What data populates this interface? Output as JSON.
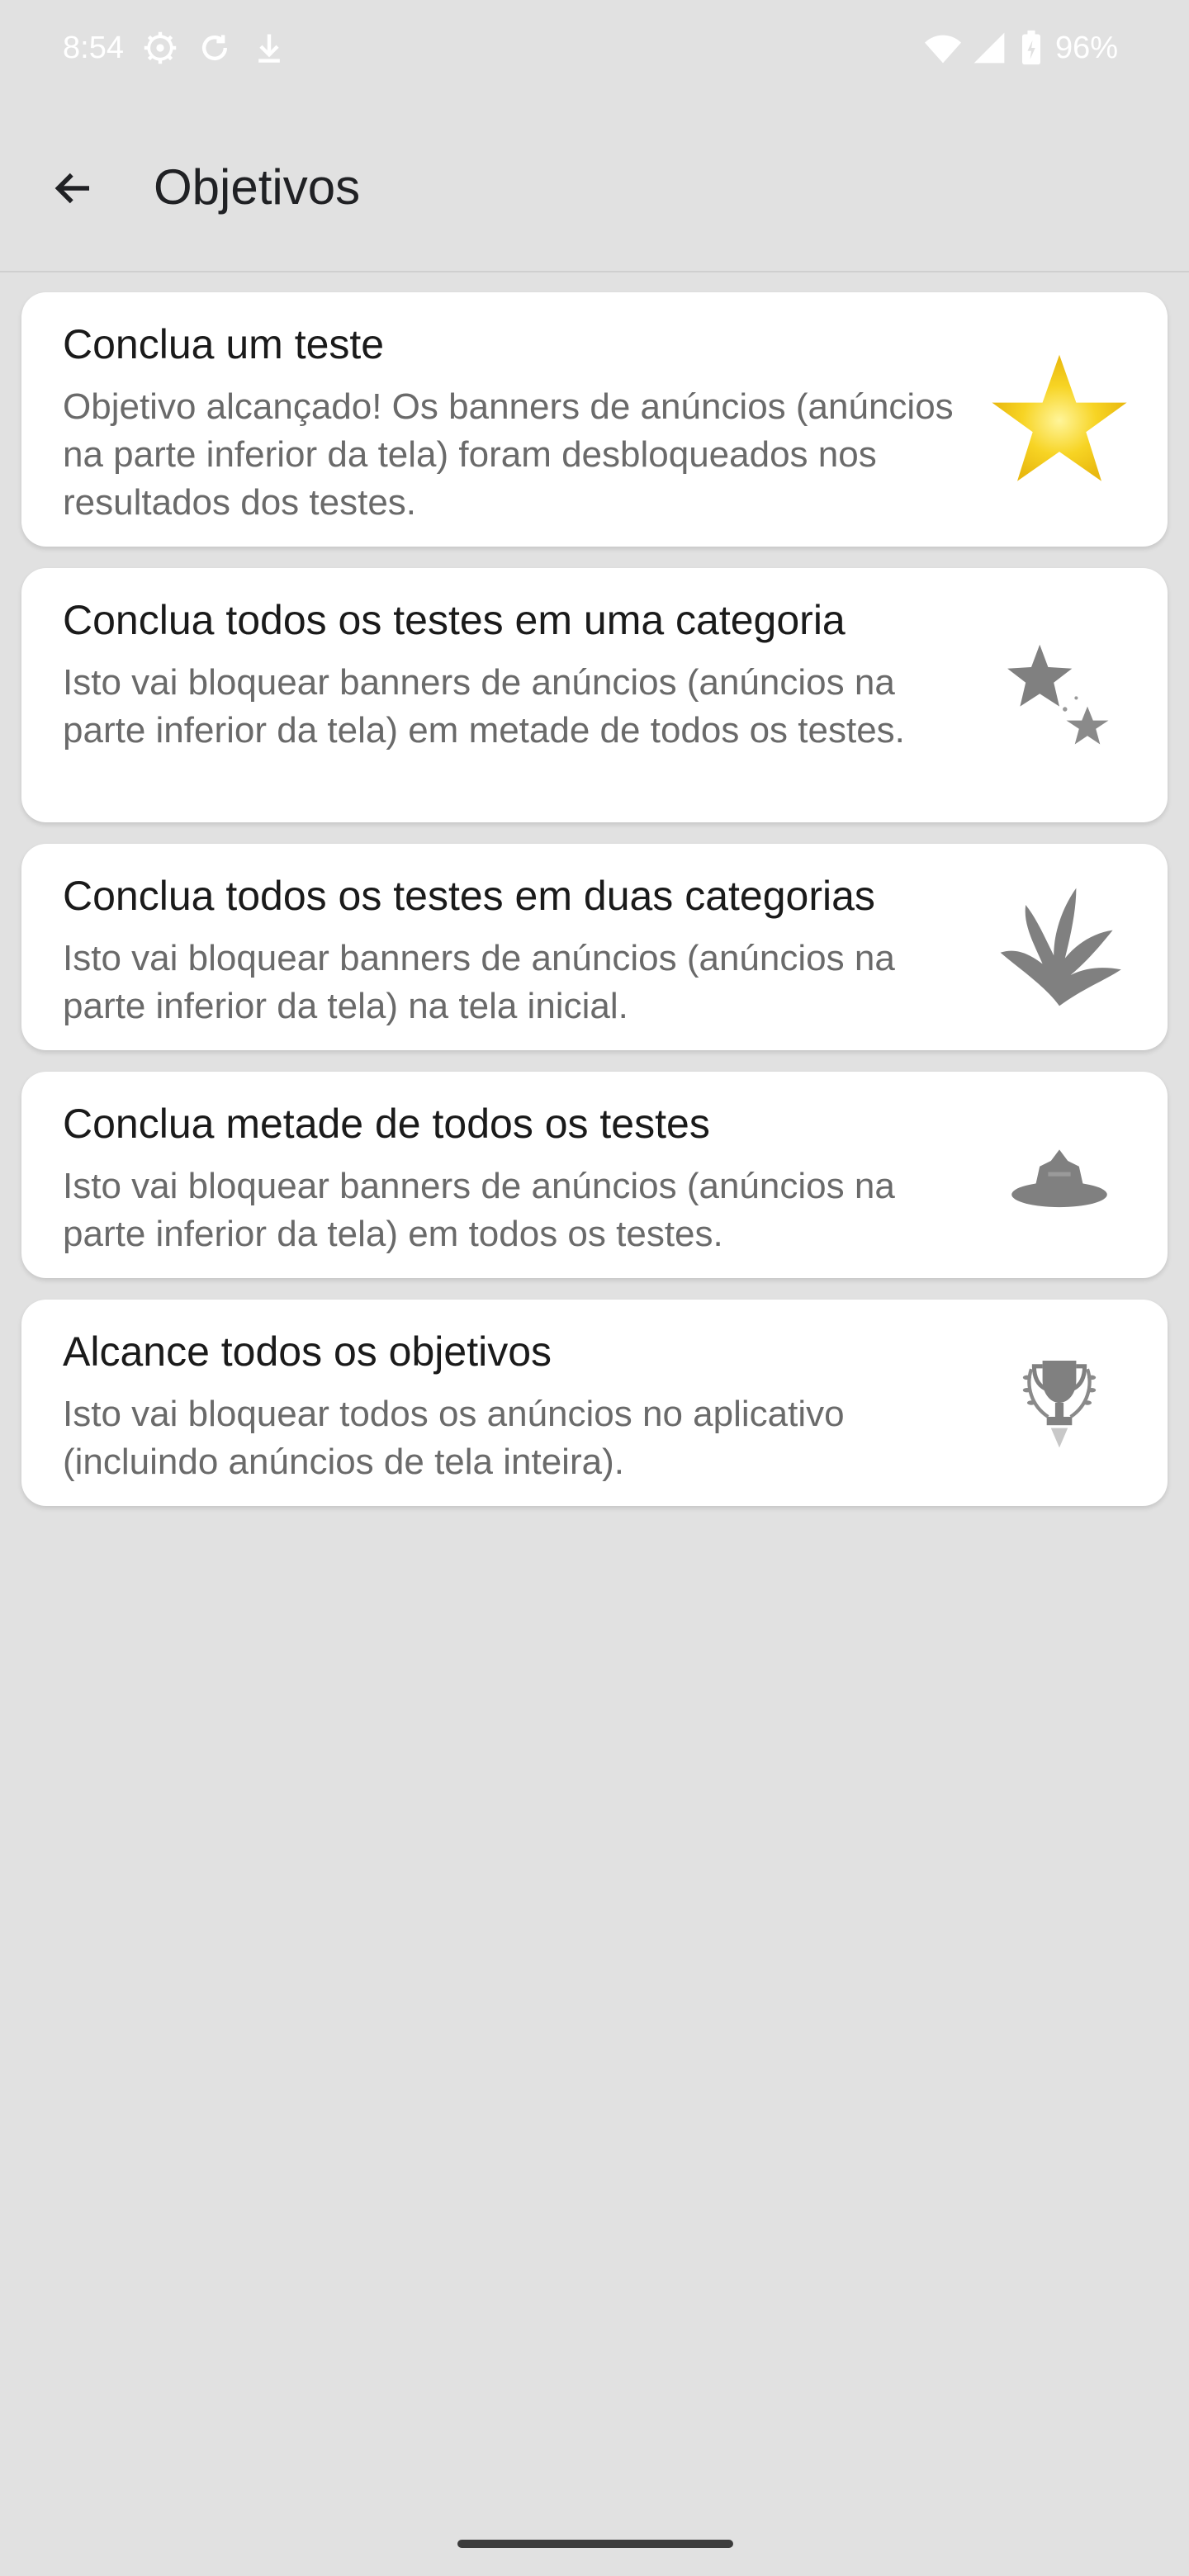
{
  "status_bar": {
    "time": "8:54",
    "battery": "96%",
    "icons": [
      "settings-icon",
      "sync-icon",
      "download-icon",
      "wifi-icon",
      "signal-icon",
      "battery-icon"
    ]
  },
  "app_bar": {
    "title": "Objetivos",
    "back_icon": "arrow-back-icon"
  },
  "objectives": [
    {
      "title": "Conclua um teste",
      "description": "Objetivo alcançado! Os banners de anúncios (anúncios na parte inferior da tela) foram desbloqueados nos resultados dos testes.",
      "icon": "gold-star-icon",
      "achieved": true
    },
    {
      "title": "Conclua todos os testes em uma categoria",
      "description": "Isto vai bloquear banners de anúncios (anúncios na parte inferior da tela) em metade de todos os testes.",
      "icon": "two-stars-icon",
      "achieved": false
    },
    {
      "title": "Conclua todos os testes em duas categorias",
      "description": "Isto vai bloquear banners de anúncios (anúncios na parte inferior da tela) na tela inicial.",
      "icon": "fireworks-icon",
      "achieved": false
    },
    {
      "title": "Conclua metade de todos os testes",
      "description": "Isto vai bloquear banners de anúncios (anúncios na parte inferior da tela) em todos os testes.",
      "icon": "hat-icon",
      "achieved": false
    },
    {
      "title": "Alcance todos os objetivos",
      "description": "Isto vai bloquear todos os anúncios no aplicativo (incluindo anúncios de tela inteira).",
      "icon": "trophy-icon",
      "achieved": false
    }
  ],
  "colors": {
    "background": "#e1e1e1",
    "card": "#ffffff",
    "title_text": "#1a1a1a",
    "desc_text": "#6a6a6a",
    "achieved_icon": "#f7d21e",
    "locked_icon": "#808080"
  }
}
